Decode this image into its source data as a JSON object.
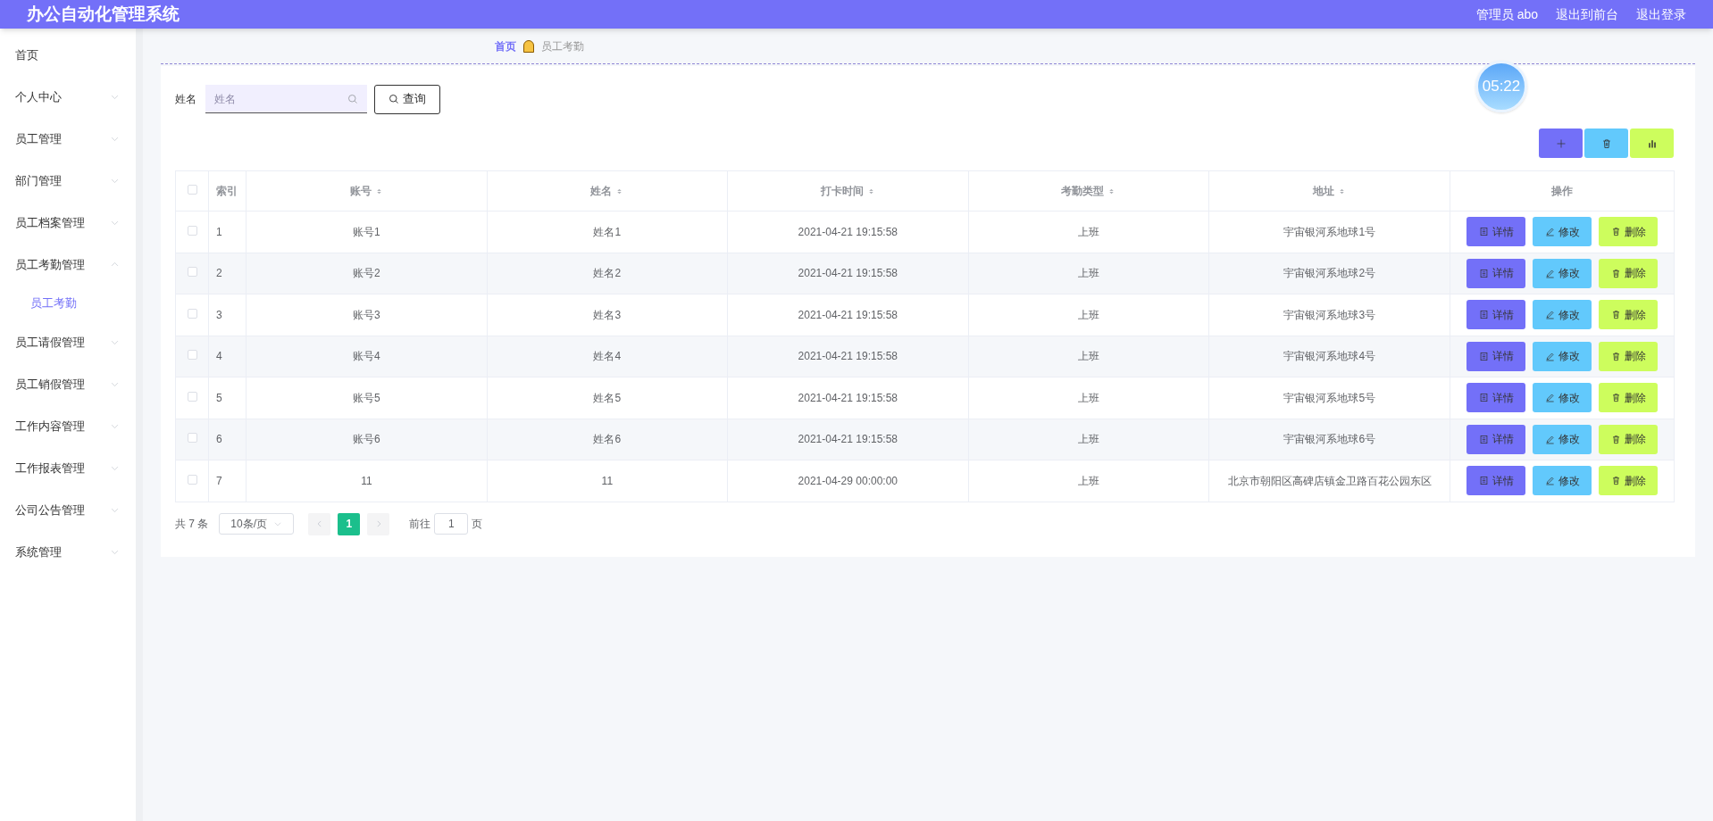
{
  "header": {
    "title": "办公自动化管理系统",
    "links": [
      "管理员 abo",
      "退出到前台",
      "退出登录"
    ]
  },
  "sidebar": {
    "items": [
      {
        "label": "首页",
        "has_arrow": false
      },
      {
        "label": "个人中心",
        "has_arrow": true,
        "expanded": false
      },
      {
        "label": "员工管理",
        "has_arrow": true,
        "expanded": false
      },
      {
        "label": "部门管理",
        "has_arrow": true,
        "expanded": false
      },
      {
        "label": "员工档案管理",
        "has_arrow": true,
        "expanded": false
      },
      {
        "label": "员工考勤管理",
        "has_arrow": true,
        "expanded": true,
        "children": [
          {
            "label": "员工考勤",
            "selected": true
          }
        ]
      },
      {
        "label": "员工请假管理",
        "has_arrow": true,
        "expanded": false
      },
      {
        "label": "员工销假管理",
        "has_arrow": true,
        "expanded": false
      },
      {
        "label": "工作内容管理",
        "has_arrow": true,
        "expanded": false
      },
      {
        "label": "工作报表管理",
        "has_arrow": true,
        "expanded": false
      },
      {
        "label": "公司公告管理",
        "has_arrow": true,
        "expanded": false
      },
      {
        "label": "系统管理",
        "has_arrow": true,
        "expanded": false
      }
    ]
  },
  "breadcrumb": [
    "首页",
    "员工考勤"
  ],
  "clock": "05:22",
  "search": {
    "label": "姓名",
    "placeholder": "姓名",
    "button": "查询"
  },
  "toolbar": [
    {
      "kind": "add"
    },
    {
      "kind": "delete"
    },
    {
      "kind": "chart"
    }
  ],
  "table": {
    "select_all_checked": false,
    "columns": [
      {
        "label": "索引",
        "sortable": false
      },
      {
        "label": "账号",
        "sortable": true
      },
      {
        "label": "姓名",
        "sortable": true
      },
      {
        "label": "打卡时间",
        "sortable": true
      },
      {
        "label": "考勤类型",
        "sortable": true
      },
      {
        "label": "地址",
        "sortable": true
      },
      {
        "label": "操作",
        "sortable": false
      }
    ],
    "rows": [
      {
        "checked": false,
        "cells": [
          "1",
          "账号1",
          "姓名1",
          "2021-04-21 19:15:58",
          "上班",
          "宇宙银河系地球1号"
        ],
        "actions": [
          {
            "kind": "detail",
            "label": "详情"
          },
          {
            "kind": "edit",
            "label": "修改"
          },
          {
            "kind": "delete",
            "label": "删除"
          }
        ]
      },
      {
        "checked": false,
        "cells": [
          "2",
          "账号2",
          "姓名2",
          "2021-04-21 19:15:58",
          "上班",
          "宇宙银河系地球2号"
        ],
        "actions": [
          {
            "kind": "detail",
            "label": "详情"
          },
          {
            "kind": "edit",
            "label": "修改"
          },
          {
            "kind": "delete",
            "label": "删除"
          }
        ]
      },
      {
        "checked": false,
        "cells": [
          "3",
          "账号3",
          "姓名3",
          "2021-04-21 19:15:58",
          "上班",
          "宇宙银河系地球3号"
        ],
        "actions": [
          {
            "kind": "detail",
            "label": "详情"
          },
          {
            "kind": "edit",
            "label": "修改"
          },
          {
            "kind": "delete",
            "label": "删除"
          }
        ]
      },
      {
        "checked": false,
        "cells": [
          "4",
          "账号4",
          "姓名4",
          "2021-04-21 19:15:58",
          "上班",
          "宇宙银河系地球4号"
        ],
        "actions": [
          {
            "kind": "detail",
            "label": "详情"
          },
          {
            "kind": "edit",
            "label": "修改"
          },
          {
            "kind": "delete",
            "label": "删除"
          }
        ]
      },
      {
        "checked": false,
        "cells": [
          "5",
          "账号5",
          "姓名5",
          "2021-04-21 19:15:58",
          "上班",
          "宇宙银河系地球5号"
        ],
        "actions": [
          {
            "kind": "detail",
            "label": "详情"
          },
          {
            "kind": "edit",
            "label": "修改"
          },
          {
            "kind": "delete",
            "label": "删除"
          }
        ]
      },
      {
        "checked": false,
        "cells": [
          "6",
          "账号6",
          "姓名6",
          "2021-04-21 19:15:58",
          "上班",
          "宇宙银河系地球6号"
        ],
        "actions": [
          {
            "kind": "detail",
            "label": "详情"
          },
          {
            "kind": "edit",
            "label": "修改"
          },
          {
            "kind": "delete",
            "label": "删除"
          }
        ]
      },
      {
        "checked": false,
        "cells": [
          "7",
          "11",
          "11",
          "2021-04-29 00:00:00",
          "上班",
          "北京市朝阳区高碑店镇金卫路百花公园东区"
        ],
        "actions": [
          {
            "kind": "detail",
            "label": "详情"
          },
          {
            "kind": "edit",
            "label": "修改"
          },
          {
            "kind": "delete",
            "label": "删除"
          }
        ]
      }
    ]
  },
  "pagination": {
    "total": "共 7 条",
    "page_size": "10条/页",
    "pages": [
      {
        "label": "1",
        "selected": true
      }
    ],
    "goto_label": "前往",
    "goto_value": "1",
    "goto_suffix": "页"
  }
}
